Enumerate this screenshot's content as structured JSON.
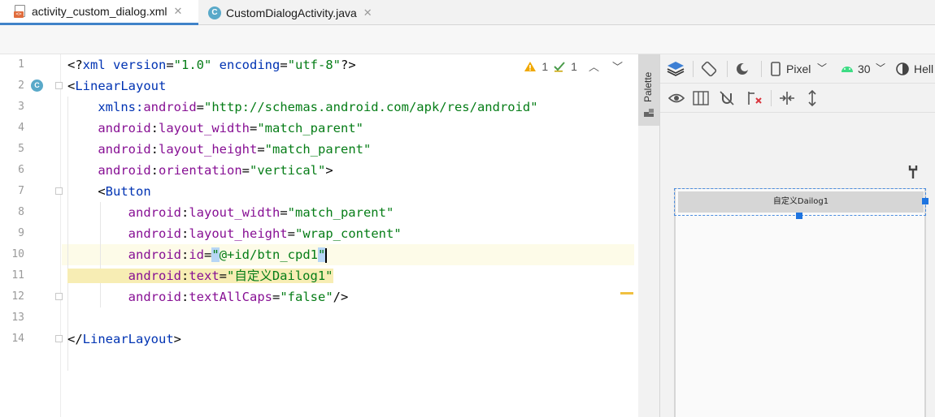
{
  "tabs": [
    {
      "label": "activity_custom_dialog.xml",
      "icon": "xml-file-icon",
      "active": true
    },
    {
      "label": "CustomDialogActivity.java",
      "icon": "java-class-icon",
      "active": false
    }
  ],
  "editor": {
    "line_numbers": [
      "1",
      "2",
      "3",
      "4",
      "5",
      "6",
      "7",
      "8",
      "9",
      "10",
      "11",
      "12",
      "13",
      "14"
    ],
    "inspections": {
      "warnings": "1",
      "weak_warnings": "1"
    },
    "lines": [
      {
        "parts": [
          {
            "t": "<?",
            "c": "plain"
          },
          {
            "t": "xml ",
            "c": "tag"
          },
          {
            "t": "version",
            "c": "tag"
          },
          {
            "t": "=",
            "c": "plain"
          },
          {
            "t": "\"1.0\"",
            "c": "val"
          },
          {
            "t": " encoding",
            "c": "tag"
          },
          {
            "t": "=",
            "c": "plain"
          },
          {
            "t": "\"utf-8\"",
            "c": "val"
          },
          {
            "t": "?>",
            "c": "plain"
          }
        ]
      },
      {
        "parts": [
          {
            "t": "<",
            "c": "plain"
          },
          {
            "t": "LinearLayout",
            "c": "tag"
          }
        ]
      },
      {
        "parts": [
          {
            "t": "    xmlns:",
            "c": "tag"
          },
          {
            "t": "android",
            "c": "attr"
          },
          {
            "t": "=",
            "c": "plain"
          },
          {
            "t": "\"http://schemas.android.com/apk/res/android\"",
            "c": "val"
          }
        ]
      },
      {
        "parts": [
          {
            "t": "    android",
            "c": "attr"
          },
          {
            "t": ":",
            "c": "plain"
          },
          {
            "t": "layout_width",
            "c": "attr"
          },
          {
            "t": "=",
            "c": "plain"
          },
          {
            "t": "\"match_parent\"",
            "c": "val"
          }
        ]
      },
      {
        "parts": [
          {
            "t": "    android",
            "c": "attr"
          },
          {
            "t": ":",
            "c": "plain"
          },
          {
            "t": "layout_height",
            "c": "attr"
          },
          {
            "t": "=",
            "c": "plain"
          },
          {
            "t": "\"match_parent\"",
            "c": "val"
          }
        ]
      },
      {
        "parts": [
          {
            "t": "    android",
            "c": "attr"
          },
          {
            "t": ":",
            "c": "plain"
          },
          {
            "t": "orientation",
            "c": "attr"
          },
          {
            "t": "=",
            "c": "plain"
          },
          {
            "t": "\"vertical\"",
            "c": "val"
          },
          {
            "t": ">",
            "c": "plain"
          }
        ]
      },
      {
        "parts": [
          {
            "t": "    <",
            "c": "plain"
          },
          {
            "t": "Button",
            "c": "tag"
          }
        ]
      },
      {
        "parts": [
          {
            "t": "        android",
            "c": "attr"
          },
          {
            "t": ":",
            "c": "plain"
          },
          {
            "t": "layout_width",
            "c": "attr"
          },
          {
            "t": "=",
            "c": "plain"
          },
          {
            "t": "\"match_parent\"",
            "c": "val"
          }
        ]
      },
      {
        "parts": [
          {
            "t": "        android",
            "c": "attr"
          },
          {
            "t": ":",
            "c": "plain"
          },
          {
            "t": "layout_height",
            "c": "attr"
          },
          {
            "t": "=",
            "c": "plain"
          },
          {
            "t": "\"wrap_content\"",
            "c": "val"
          }
        ]
      },
      {
        "parts": [
          {
            "t": "        android",
            "c": "attr"
          },
          {
            "t": ":",
            "c": "plain"
          },
          {
            "t": "id",
            "c": "attr"
          },
          {
            "t": "=",
            "c": "plain"
          },
          {
            "t": "\"",
            "c": "val",
            "h": "hlq"
          },
          {
            "t": "@+id/btn_cpd1",
            "c": "val"
          },
          {
            "t": "\"",
            "c": "val",
            "h": "hlq"
          },
          {
            "caret": true
          }
        ]
      },
      {
        "parts": [
          {
            "t": "        android",
            "c": "attr",
            "h": "hltext"
          },
          {
            "t": ":",
            "c": "plain",
            "h": "hltext"
          },
          {
            "t": "text",
            "c": "attr",
            "h": "hltext"
          },
          {
            "t": "=",
            "c": "plain",
            "h": "hltext"
          },
          {
            "t": "\"自定义Dailog1\"",
            "c": "val",
            "h": "hltext"
          }
        ]
      },
      {
        "parts": [
          {
            "t": "        android",
            "c": "attr"
          },
          {
            "t": ":",
            "c": "plain"
          },
          {
            "t": "textAllCaps",
            "c": "attr"
          },
          {
            "t": "=",
            "c": "plain"
          },
          {
            "t": "\"false\"",
            "c": "val"
          },
          {
            "t": "/>",
            "c": "plain"
          }
        ]
      },
      {
        "parts": []
      },
      {
        "parts": [
          {
            "t": "</",
            "c": "plain"
          },
          {
            "t": "LinearLayout",
            "c": "tag"
          },
          {
            "t": ">",
            "c": "plain"
          }
        ]
      }
    ]
  },
  "palette": {
    "label": "Palette"
  },
  "designer": {
    "device": "Pixel",
    "api_level": "30",
    "theme_partial": "Hell",
    "preview_button_text": "自定义Dailog1"
  },
  "colors": {
    "accent": "#4083c9",
    "selection": "#1e74e0"
  }
}
